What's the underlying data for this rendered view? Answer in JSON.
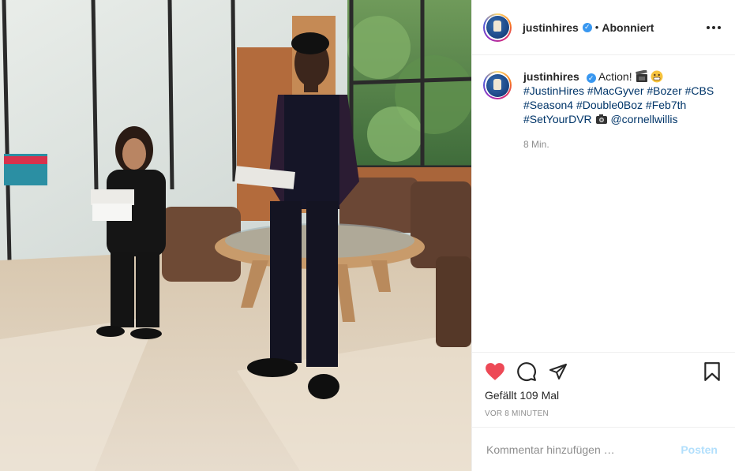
{
  "post": {
    "author": {
      "username": "justinhires",
      "verified": true,
      "avatar_icon": "avatar-icon"
    },
    "header": {
      "separator": "•",
      "follow_status": "Abonniert"
    },
    "caption": {
      "text_prefix": "Action!",
      "hashtags": [
        "#JustinHires",
        "#MacGyver",
        "#Bozer",
        "#CBS",
        "#Season4",
        "#Double0Boz",
        "#Feb7th",
        "#SetYourDVR"
      ],
      "mention": "@cornellwillis",
      "emojis": [
        "clapper-board-emoji",
        "grinning-face-emoji",
        "camera-emoji"
      ],
      "age": "8 Min."
    },
    "stats": {
      "likes_label": "Gefällt 109 Mal",
      "timestamp": "vor 8 Minuten",
      "liked": true
    },
    "comment_box": {
      "placeholder": "Kommentar hinzufügen …",
      "submit_label": "Posten"
    }
  },
  "colors": {
    "like_red": "#ed4956",
    "link_blue": "#003569",
    "verified_blue": "#3897f0",
    "muted": "#8e8e8e",
    "post_button_disabled": "#b2dffc"
  }
}
